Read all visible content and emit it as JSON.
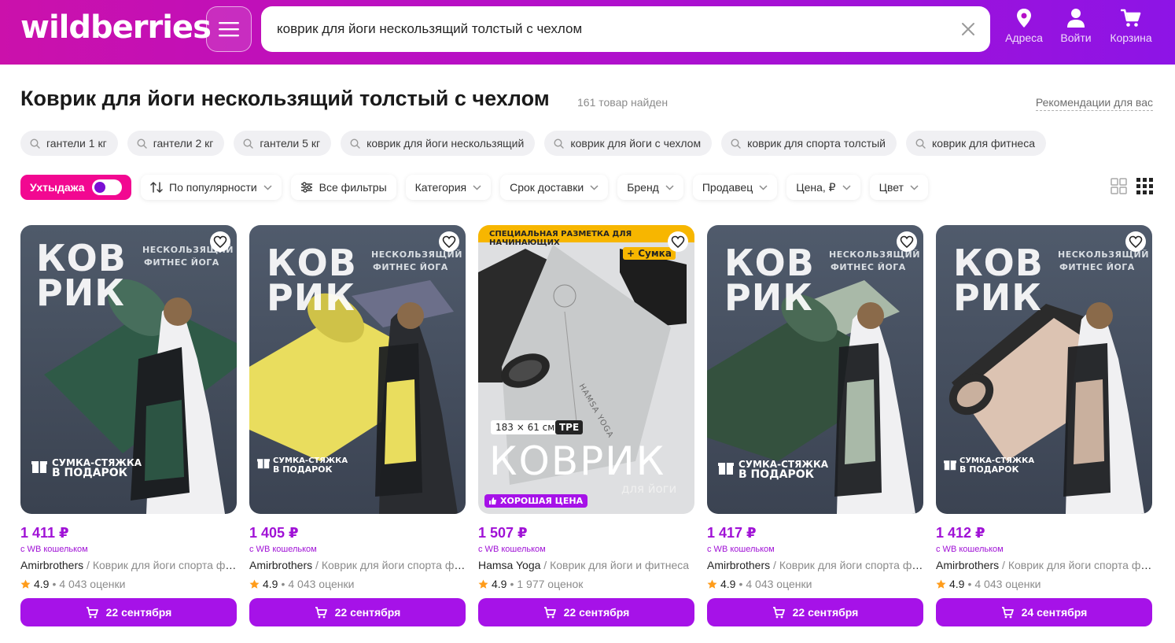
{
  "header": {
    "logo": "wildberries",
    "search_value": "коврик для йоги нескользящий толстый с чехлом",
    "nav": [
      {
        "label": "Адреса",
        "icon": "location-pin-icon"
      },
      {
        "label": "Войти",
        "icon": "user-icon"
      },
      {
        "label": "Корзина",
        "icon": "cart-icon"
      }
    ]
  },
  "results": {
    "title": "Коврик для йоги нескользящий толстый с чехлом",
    "found": "161 товар найден",
    "recommendations": "Рекомендации для вас"
  },
  "chips": [
    "гантели 1 кг",
    "гантели 2 кг",
    "гантели 5 кг",
    "коврик для йоги нескользящий",
    "коврик для йоги с чехлом",
    "коврик для спорта толстый",
    "коврик для фитнеса"
  ],
  "filters": {
    "toggle_label": "Ухтыдажа",
    "sort": "По популярности",
    "all_filters": "Все фильтры",
    "dropdowns": [
      "Категория",
      "Срок доставки",
      "Бренд",
      "Продавец",
      "Цена, ₽",
      "Цвет"
    ]
  },
  "colors": {
    "accent": "#a612e8",
    "pink": "#f20891",
    "header_start": "#cb11ab",
    "header_end": "#8d14e6"
  },
  "products": [
    {
      "price": "1 411 ₽",
      "wallet": "с WB кошельком",
      "brand": "Amirbrothers",
      "name": "Коврик для йоги спорта фитнеса",
      "rating": "4.9",
      "reviews": "4 043 оценки",
      "delivery": "22 сентября",
      "img_big1": "КОВ",
      "img_big2": "РИК",
      "img_tag1": "НЕСКОЛЬЗЯЩИЙ",
      "img_tag2": "ФИТНЕС   ЙОГА",
      "img_gift1": "СУМКА-СТЯЖКА",
      "img_gift2": "В ПОДАРОК",
      "mat_color": "#2f5a47",
      "mat_edge": "#476e5c"
    },
    {
      "price": "1 405 ₽",
      "wallet": "с WB кошельком",
      "brand": "Amirbrothers",
      "name": "Коврик для йоги спорта фитнеса",
      "rating": "4.9",
      "reviews": "4 043 оценки",
      "delivery": "22 сентября",
      "img_big1": "КОВ",
      "img_big2": "РИК",
      "img_tag1": "НЕСКОЛЬЗЯЩИЙ",
      "img_tag2": "ФИТНЕС   ЙОГА",
      "img_gift1": "СУМКА-СТЯЖКА",
      "img_gift2": "В ПОДАРОК",
      "mat_color": "#e9dd5e",
      "mat_edge": "#cfc248"
    },
    {
      "price": "1 507 ₽",
      "wallet": "с WB кошельком",
      "brand": "Hamsa Yoga",
      "name": "Коврик для йоги и фитнеса",
      "rating": "4.9",
      "reviews": "1 977 оценок",
      "delivery": "22 сентября",
      "img_banner": "СПЕЦИАЛЬНАЯ РАЗМЕТКА ДЛЯ НАЧИНАЮЩИХ",
      "img_bag": "+ Сумка",
      "img_size": "183 × 61 см",
      "img_material": "TPE",
      "img_big": "КОВРИК",
      "img_sub": "для йоги",
      "img_badge": "ХОРОШАЯ ЦЕНА",
      "img_brand": "HAMSA YOGA"
    },
    {
      "price": "1 417 ₽",
      "wallet": "с WB кошельком",
      "brand": "Amirbrothers",
      "name": "Коврик для йоги спорта фитнеса",
      "rating": "4.9",
      "reviews": "4 043 оценки",
      "delivery": "22 сентября",
      "img_big1": "КОВ",
      "img_big2": "РИК",
      "img_tag1": "НЕСКОЛЬЗЯЩИЙ",
      "img_tag2": "ФИТНЕС   ЙОГА",
      "img_gift1": "СУМКА-СТЯЖКА",
      "img_gift2": "В ПОДАРОК",
      "mat_color": "#34513e",
      "mat_edge": "#a9b9a8"
    },
    {
      "price": "1 412 ₽",
      "wallet": "с WB кошельком",
      "brand": "Amirbrothers",
      "name": "Коврик для йоги спорта фитнеса",
      "rating": "4.9",
      "reviews": "4 043 оценки",
      "delivery": "24 сентября",
      "img_big1": "КОВ",
      "img_big2": "РИК",
      "img_tag1": "НЕСКОЛЬЗЯЩИЙ",
      "img_tag2": "ФИТНЕС   ЙОГА",
      "img_gift1": "СУМКА-СТЯЖКА",
      "img_gift2": "В ПОДАРОК",
      "mat_color": "#dcc3b2",
      "mat_edge": "#2b2b2b"
    }
  ]
}
